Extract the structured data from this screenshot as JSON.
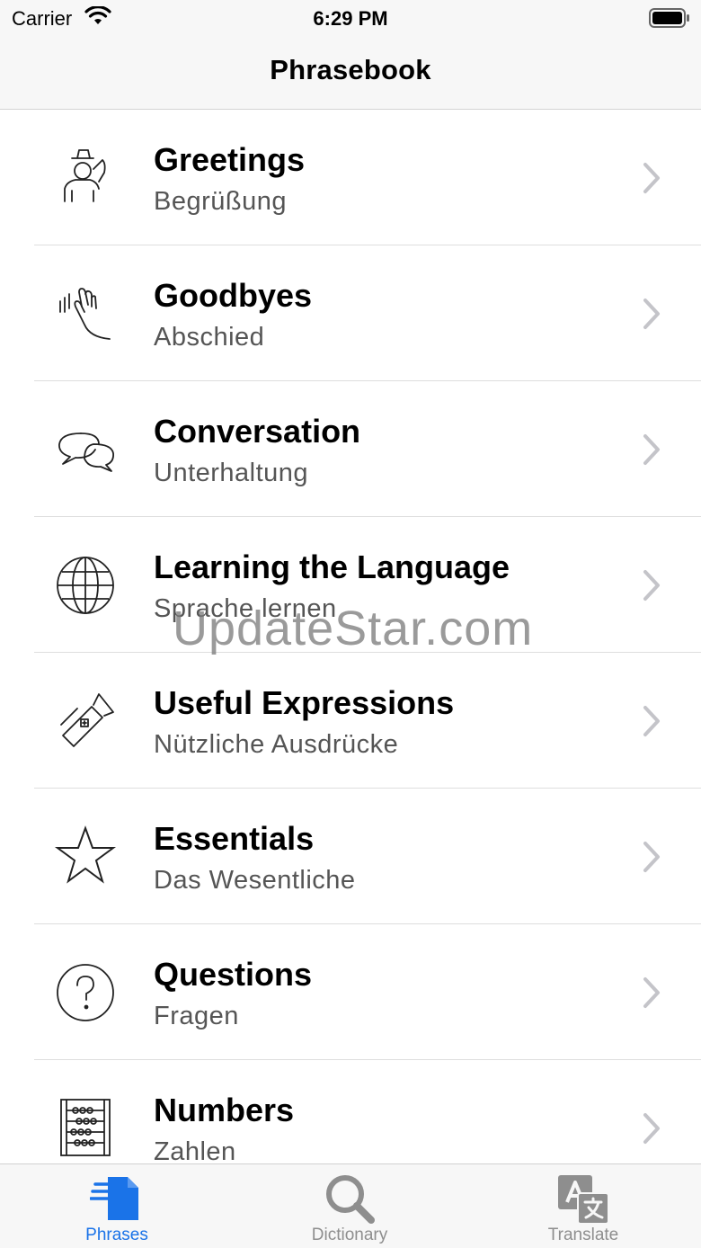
{
  "status_bar": {
    "carrier": "Carrier",
    "time": "6:29 PM"
  },
  "nav": {
    "title": "Phrasebook"
  },
  "categories": [
    {
      "title": "Greetings",
      "subtitle": "Begrüßung",
      "icon": "person-hat-icon"
    },
    {
      "title": "Goodbyes",
      "subtitle": "Abschied",
      "icon": "waving-hand-icon"
    },
    {
      "title": "Conversation",
      "subtitle": "Unterhaltung",
      "icon": "speech-bubbles-icon"
    },
    {
      "title": "Learning the Language",
      "subtitle": "Sprache lernen",
      "icon": "globe-icon"
    },
    {
      "title": "Useful Expressions",
      "subtitle": "Nützliche Ausdrücke",
      "icon": "pocket-knife-icon"
    },
    {
      "title": "Essentials",
      "subtitle": "Das Wesentliche",
      "icon": "star-icon"
    },
    {
      "title": "Questions",
      "subtitle": "Fragen",
      "icon": "question-circle-icon"
    },
    {
      "title": "Numbers",
      "subtitle": "Zahlen",
      "icon": "abacus-icon"
    }
  ],
  "watermark": "UpdateStar.com",
  "tabs": [
    {
      "label": "Phrases",
      "icon": "document-stack-icon",
      "active": true
    },
    {
      "label": "Dictionary",
      "icon": "magnifier-icon",
      "active": false
    },
    {
      "label": "Translate",
      "icon": "translate-icon",
      "active": false
    }
  ],
  "colors": {
    "accent": "#1a73e8",
    "inactive": "#8e8e8e",
    "bar_bg": "#f7f7f7"
  }
}
